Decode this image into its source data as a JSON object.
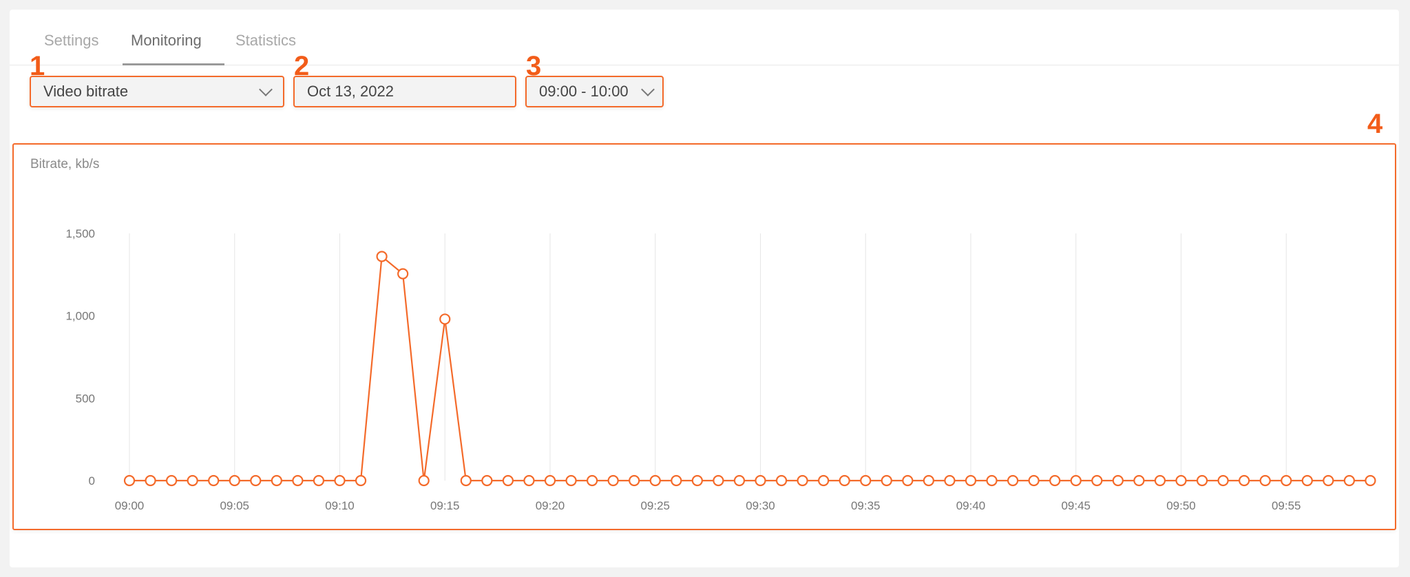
{
  "tabs": [
    {
      "label": "Settings"
    },
    {
      "label": "Monitoring",
      "active": true
    },
    {
      "label": "Statistics"
    }
  ],
  "markers": [
    "1",
    "2",
    "3",
    "4"
  ],
  "controls": {
    "metric_select": {
      "value": "Video bitrate",
      "icon": "chevron-down-icon"
    },
    "date_field": {
      "value": "Oct 13, 2022"
    },
    "time_range_select": {
      "value": "09:00 - 10:00",
      "icon": "chevron-down-icon"
    }
  },
  "colors": {
    "accent": "#f25c19",
    "line": "#f46a2a",
    "grid": "#e6e6e6"
  },
  "chart_data": {
    "type": "line",
    "title": "",
    "ylabel": "Bitrate, kb/s",
    "xlabel": "",
    "ylim": [
      0,
      1500
    ],
    "yticks": [
      0,
      500,
      1000,
      1500
    ],
    "ytick_labels": [
      "0",
      "500",
      "1,000",
      "1,500"
    ],
    "xtick_labels": [
      "09:00",
      "09:05",
      "09:10",
      "09:15",
      "09:20",
      "09:25",
      "09:30",
      "09:35",
      "09:40",
      "09:45",
      "09:50",
      "09:55"
    ],
    "grid": true,
    "series": [
      {
        "values": [
          0,
          0,
          0,
          0,
          0,
          0,
          0,
          0,
          0,
          0,
          0,
          0,
          1360,
          1255,
          0,
          980,
          0,
          0,
          0,
          0,
          0,
          0,
          0,
          0,
          0,
          0,
          0,
          0,
          0,
          0,
          0,
          0,
          0,
          0,
          0,
          0,
          0,
          0,
          0,
          0,
          0,
          0,
          0,
          0,
          0,
          0,
          0,
          0,
          0,
          0,
          0,
          0,
          0,
          0,
          0,
          0,
          0,
          0,
          0,
          0
        ]
      }
    ]
  }
}
